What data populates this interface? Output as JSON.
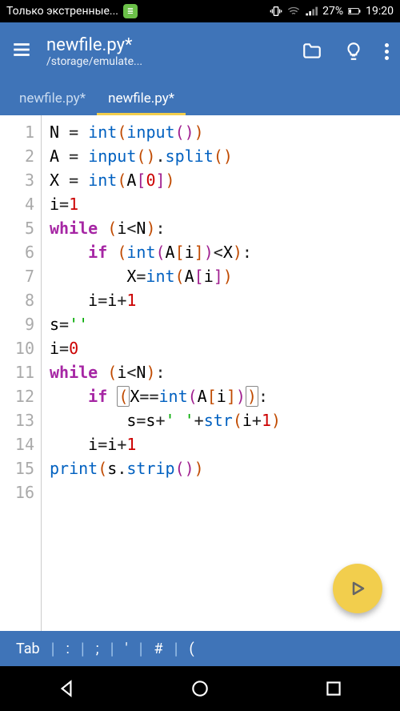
{
  "statusbar": {
    "carrier_text": "Только экстренные...",
    "battery_pct": "27%",
    "clock": "19:20"
  },
  "toolbar": {
    "title": "newfile.py*",
    "subtitle": "/storage/emulate..."
  },
  "tabs": [
    {
      "label": "newfile.py*",
      "active": false
    },
    {
      "label": "newfile.py*",
      "active": true
    }
  ],
  "code": {
    "lines": [
      "N = int(input())",
      "A = input().split()",
      "X = int(A[0])",
      "i=1",
      "while (i<N):",
      "    if (int(A[i])<X):",
      "        X=int(A[i])",
      "    i=i+1",
      "s=''",
      "i=0",
      "while (i<N):",
      "    if (X==int(A[i])):",
      "        s=s+' '+str(i+1)",
      "    i=i+1",
      "print(s.strip())",
      ""
    ]
  },
  "quickbar": {
    "items": [
      "Tab",
      ":",
      ";",
      "'",
      "#",
      "("
    ]
  },
  "fab": {
    "label": "run"
  }
}
